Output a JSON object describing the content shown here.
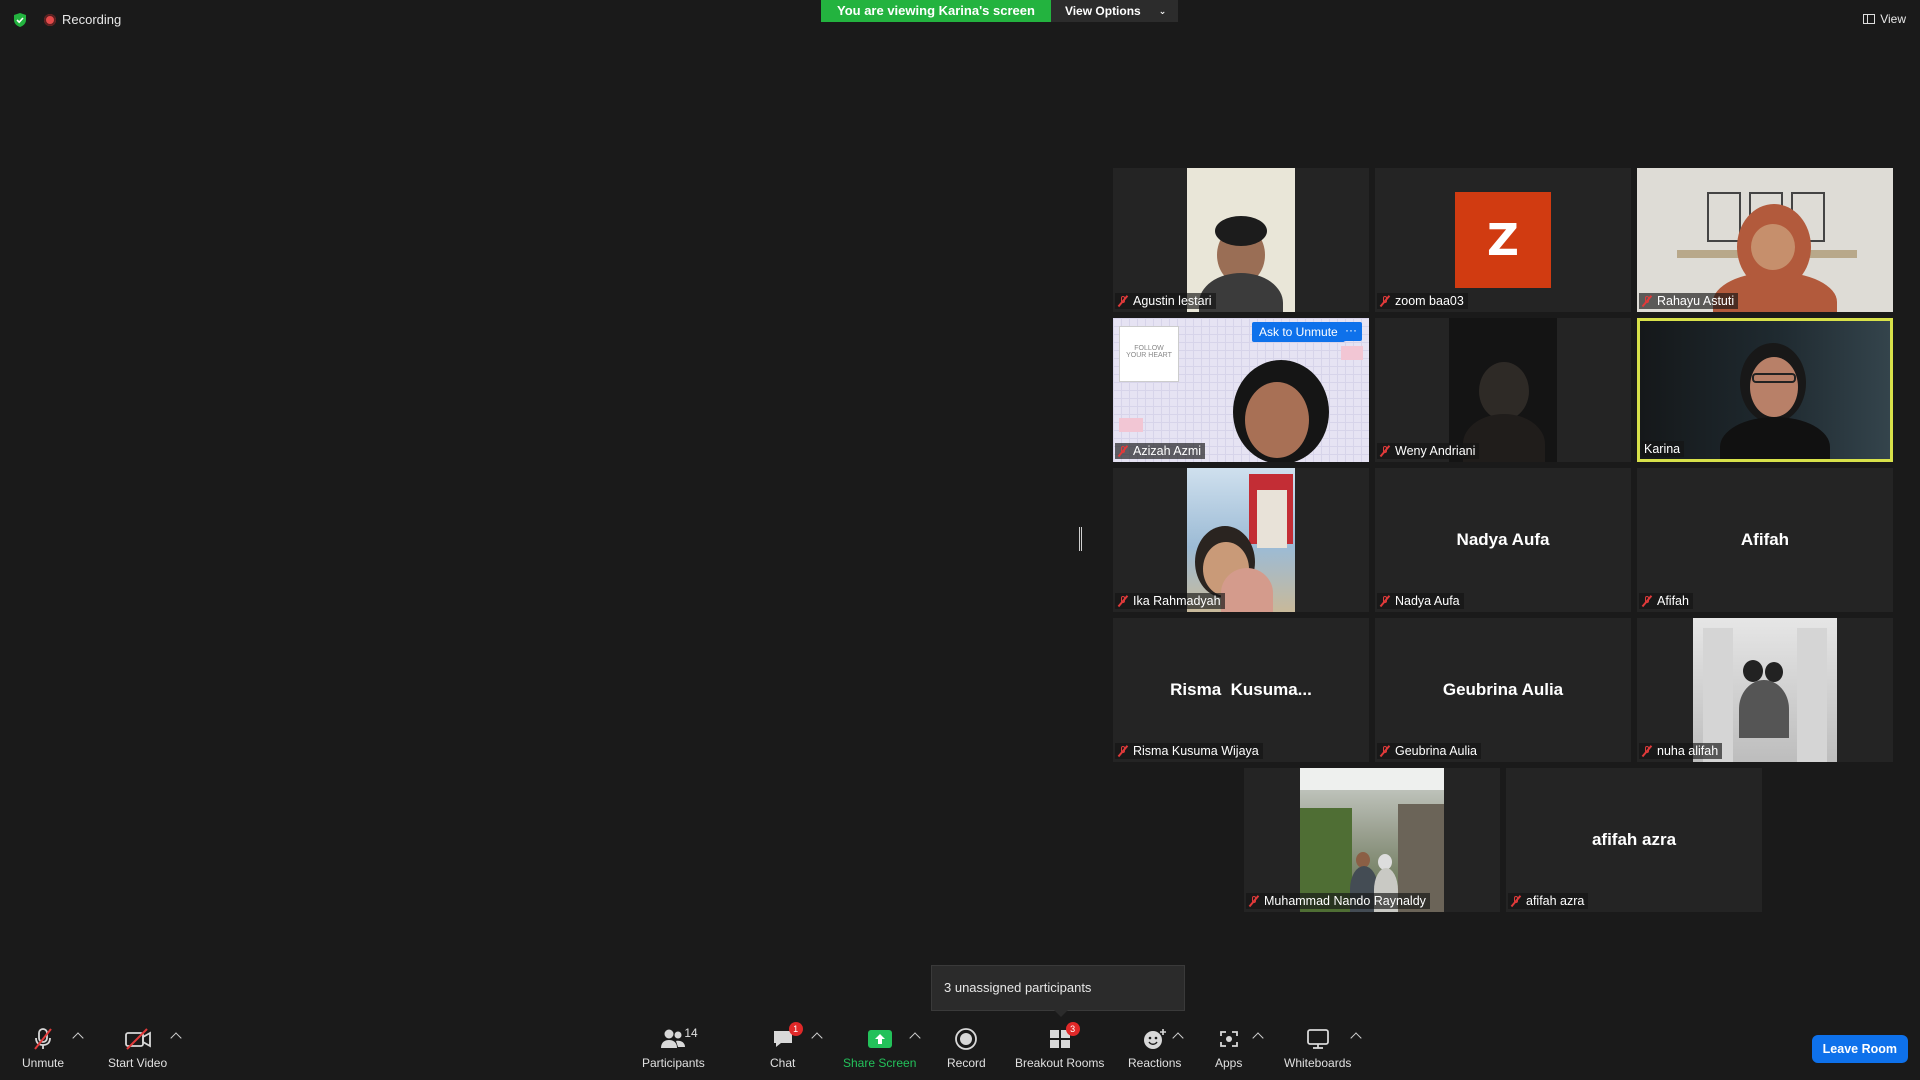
{
  "top_bar": {
    "recording_label": "Recording",
    "viewing_banner": "You are viewing Karina's screen",
    "view_options_label": "View Options",
    "view_label": "View"
  },
  "gallery": {
    "tiles": [
      {
        "name": "Agustin lestari",
        "muted": true
      },
      {
        "name": "zoom baa03",
        "muted": true,
        "avatar_letter": "Z",
        "avatar_color": "#d13b11"
      },
      {
        "name": "Rahayu Astuti",
        "muted": true
      },
      {
        "name": "Azizah Azmi",
        "muted": true,
        "ask_unmute_label": "Ask to Unmute",
        "more_label": "···"
      },
      {
        "name": "Weny Andriani",
        "muted": true
      },
      {
        "name": "Karina",
        "muted": false,
        "active_speaker": true
      },
      {
        "name": "Ika Rahmadyah",
        "muted": true
      },
      {
        "name": "Nadya Aufa",
        "muted": true,
        "center_name": "Nadya Aufa"
      },
      {
        "name": "Afifah",
        "muted": true,
        "center_name": "Afifah"
      },
      {
        "name": "Risma Kusuma Wijaya",
        "muted": true,
        "center_name": "Risma  Kusuma..."
      },
      {
        "name": "Geubrina Aulia",
        "muted": true,
        "center_name": "Geubrina Aulia"
      },
      {
        "name": "nuha alifah",
        "muted": true
      },
      {
        "name": "Muhammad Nando Raynaldy",
        "muted": true
      },
      {
        "name": "afifah azra",
        "muted": true,
        "center_name": "afifah azra"
      }
    ],
    "tile_background_note_colors": {
      "tile": "#242424",
      "active_border": "#d8e14a"
    }
  },
  "tooltip": {
    "text": "3 unassigned participants"
  },
  "toolbar": {
    "unmute_label": "Unmute",
    "start_video_label": "Start Video",
    "participants_label": "Participants",
    "participants_count": "14",
    "chat_label": "Chat",
    "chat_badge": "1",
    "share_screen_label": "Share Screen",
    "record_label": "Record",
    "breakout_label": "Breakout Rooms",
    "breakout_badge": "3",
    "reactions_label": "Reactions",
    "apps_label": "Apps",
    "whiteboards_label": "Whiteboards",
    "leave_label": "Leave Room"
  },
  "colors": {
    "accent_green": "#23b33f",
    "leave_blue": "#0e71eb",
    "muted_red": "#e03a3a"
  }
}
